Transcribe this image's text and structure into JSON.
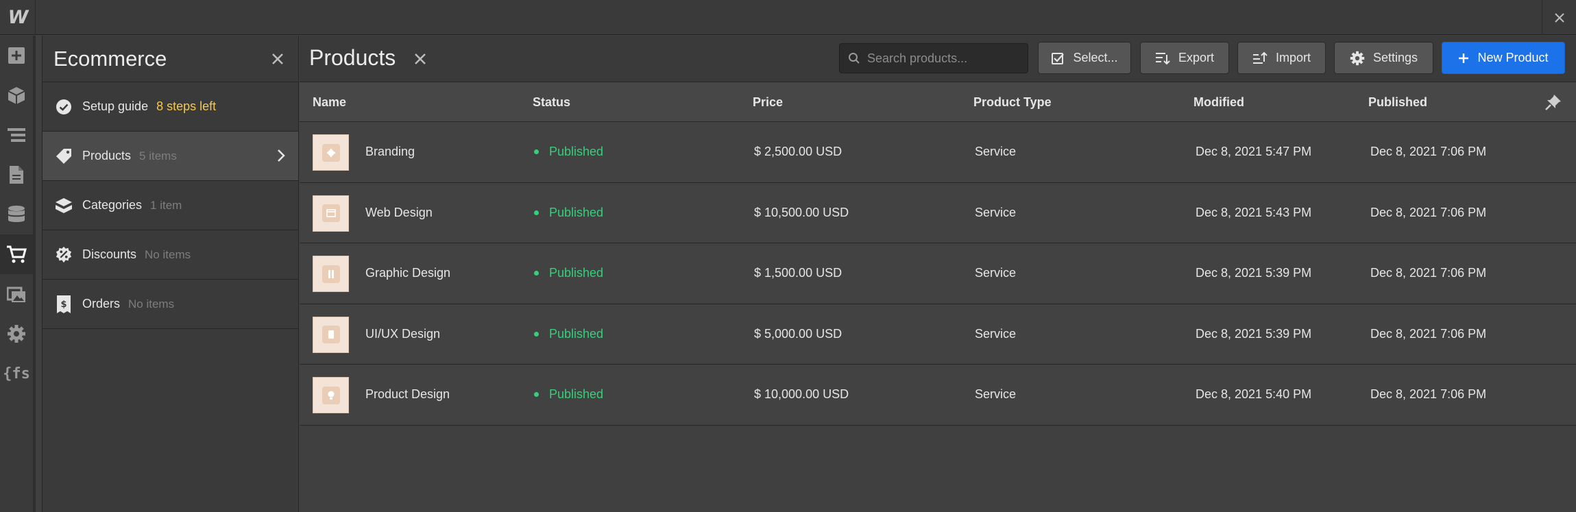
{
  "app": {
    "logo": "W"
  },
  "rail": {
    "items": [
      "add-icon",
      "box-icon",
      "navigator-icon",
      "pages-icon",
      "cms-icon",
      "cart-icon",
      "assets-icon",
      "settings-icon",
      "fs-icon"
    ],
    "fs_label": "{fs"
  },
  "panel": {
    "title": "Ecommerce",
    "items": [
      {
        "label": "Setup guide",
        "meta": "8 steps left"
      },
      {
        "label": "Products",
        "meta": "5 items"
      },
      {
        "label": "Categories",
        "meta": "1 item"
      },
      {
        "label": "Discounts",
        "meta": "No items"
      },
      {
        "label": "Orders",
        "meta": "No items"
      }
    ]
  },
  "main": {
    "title": "Products",
    "search_placeholder": "Search products...",
    "buttons": {
      "select": "Select...",
      "export": "Export",
      "import": "Import",
      "settings": "Settings",
      "new_product": "New Product"
    },
    "columns": [
      "Name",
      "Status",
      "Price",
      "Product Type",
      "Modified",
      "Published"
    ],
    "rows": [
      {
        "name": "Branding",
        "status": "Published",
        "price": "$ 2,500.00 USD",
        "type": "Service",
        "modified": "Dec 8, 2021 5:47 PM",
        "published": "Dec 8, 2021 7:06 PM"
      },
      {
        "name": "Web Design",
        "status": "Published",
        "price": "$ 10,500.00 USD",
        "type": "Service",
        "modified": "Dec 8, 2021 5:43 PM",
        "published": "Dec 8, 2021 7:06 PM"
      },
      {
        "name": "Graphic Design",
        "status": "Published",
        "price": "$ 1,500.00 USD",
        "type": "Service",
        "modified": "Dec 8, 2021 5:39 PM",
        "published": "Dec 8, 2021 7:06 PM"
      },
      {
        "name": "UI/UX Design",
        "status": "Published",
        "price": "$ 5,000.00 USD",
        "type": "Service",
        "modified": "Dec 8, 2021 5:39 PM",
        "published": "Dec 8, 2021 7:06 PM"
      },
      {
        "name": "Product Design",
        "status": "Published",
        "price": "$ 10,000.00 USD",
        "type": "Service",
        "modified": "Dec 8, 2021 5:40 PM",
        "published": "Dec 8, 2021 7:06 PM"
      }
    ]
  },
  "colors": {
    "accent": "#1c72e8",
    "published": "#34d07a",
    "steps": "#f5c84c"
  }
}
